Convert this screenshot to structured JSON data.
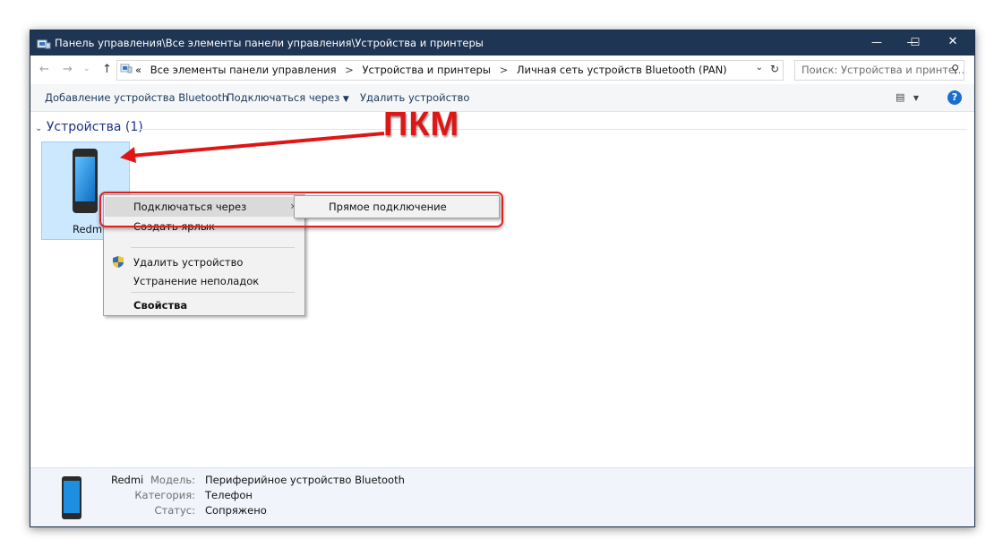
{
  "window": {
    "title": "Панель управления\\Все элементы панели управления\\Устройства и принтеры",
    "minimize": "—",
    "maximize": "☐",
    "close": "✕"
  },
  "addressbar": {
    "overflow": "«",
    "crumbs": [
      "Все элементы панели управления",
      "Устройства и принтеры",
      "Личная сеть устройств Bluetooth (PAN)"
    ],
    "separator": ">",
    "search_placeholder": "Поиск: Устройства и принте...",
    "icons": [
      "back-icon",
      "forward-icon",
      "recent-icon",
      "up-icon",
      "control-panel-icon",
      "dropdown-icon",
      "refresh-icon",
      "search-icon"
    ]
  },
  "commandbar": {
    "add_bluetooth": "Добавление устройства Bluetooth",
    "connect_via": "Подключаться через",
    "remove_device": "Удалить устройство",
    "help": "?"
  },
  "group": {
    "label": "Устройства (1)"
  },
  "device": {
    "name": "Redmi"
  },
  "context_menu": {
    "items": [
      {
        "label": "Подключаться через"
      },
      {
        "label": "Создать ярлык"
      },
      {
        "label": "Удалить устройство"
      },
      {
        "label": "Устранение неполадок"
      },
      {
        "label": "Свойства"
      }
    ],
    "submenu": {
      "label": "Прямое подключение"
    }
  },
  "annotation": {
    "text": "ПКМ",
    "color": "#e01515"
  },
  "details": {
    "name": "Redmi",
    "fields": [
      {
        "key": "Модель:",
        "value": "Периферийное устройство Bluetooth"
      },
      {
        "key": "Категория:",
        "value": "Телефон"
      },
      {
        "key": "Статус:",
        "value": "Сопряжено"
      }
    ]
  },
  "colors": {
    "titlebar": "#1f3554",
    "selection": "#cce8ff",
    "link": "#1e395b",
    "annotation_red": "#e01515"
  }
}
